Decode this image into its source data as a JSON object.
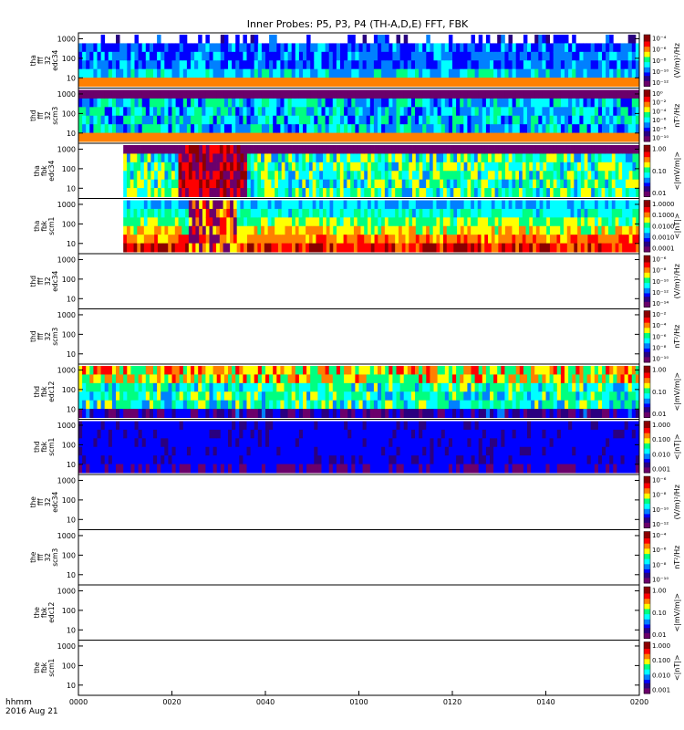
{
  "title": "Inner Probes: P5, P3, P4 (TH-A,D,E) FFT, FBK",
  "footer": {
    "line1": "hhmm",
    "line2": "2016 Aug 21"
  },
  "colors": {
    "colormap": [
      "#ffffff",
      "#6b006b",
      "#2a0080",
      "#0000ff",
      "#0080ff",
      "#00ffff",
      "#00ff80",
      "#ffff00",
      "#ff8000",
      "#ff0000",
      "#8b0000"
    ]
  },
  "chart_data": {
    "type": "heatmap",
    "title": "Inner Probes: P5, P3, P4 (TH-A,D,E) FFT, FBK",
    "x_axis": {
      "label": "hhmm",
      "date": "2016 Aug 21",
      "range": [
        "0000",
        "0200"
      ],
      "tick_labels": [
        "0000",
        "0020",
        "0040",
        "0100",
        "0120",
        "0140",
        "0200"
      ]
    },
    "y_axis": {
      "scale": "log",
      "unit": "Hz",
      "tick_labels": [
        "10",
        "100",
        "1000"
      ],
      "range": [
        3,
        2000
      ]
    },
    "panels": [
      {
        "label": [
          "tha",
          "fff",
          "32",
          "edc34"
        ],
        "colorbar_title": "(V/m)²/Hz",
        "colorbar_ticks": [
          "10⁻⁴",
          "10⁻⁶",
          "10⁻⁸",
          "10⁻¹⁰",
          "10⁻¹²"
        ],
        "pattern": "spiky"
      },
      {
        "label": [
          "thd",
          "fff",
          "32",
          "scm3"
        ],
        "colorbar_title": "nT²/Hz",
        "colorbar_ticks": [
          "10⁰",
          "10⁻²",
          "10⁻⁴",
          "10⁻⁶",
          "10⁻⁸",
          "10⁻¹⁰"
        ],
        "pattern": "scm_fff"
      },
      {
        "label": [
          "tha",
          "fbk",
          "edc34"
        ],
        "colorbar_title": "<|mV/m|>",
        "colorbar_ticks": [
          "1.00",
          "0.10",
          "0.01"
        ],
        "pattern": "fbk_a_edc"
      },
      {
        "label": [
          "tha",
          "fbk",
          "scm1"
        ],
        "colorbar_title": "<|nT|>",
        "colorbar_ticks": [
          "1.0000",
          "0.1000",
          "0.0100",
          "0.0010",
          "0.0001"
        ],
        "pattern": "fbk_a_scm"
      },
      {
        "label": [
          "thd",
          "fff",
          "32",
          "edc34"
        ],
        "colorbar_title": "(V/m)²/Hz",
        "colorbar_ticks": [
          "10⁻⁶",
          "10⁻⁸",
          "10⁻¹⁰",
          "10⁻¹²",
          "10⁻¹⁴"
        ],
        "pattern": "empty"
      },
      {
        "label": [
          "thd",
          "fff",
          "32",
          "scm3"
        ],
        "colorbar_title": "nT²/Hz",
        "colorbar_ticks": [
          "10⁻²",
          "10⁻⁴",
          "10⁻⁶",
          "10⁻⁸",
          "10⁻¹⁰"
        ],
        "pattern": "empty"
      },
      {
        "label": [
          "thd",
          "fbk",
          "edc12"
        ],
        "colorbar_title": "<|mV/m|>",
        "colorbar_ticks": [
          "1.00",
          "0.10",
          "0.01"
        ],
        "pattern": "fbk_d_edc"
      },
      {
        "label": [
          "thd",
          "fbk",
          "scm1"
        ],
        "colorbar_title": "<|nT|>",
        "colorbar_ticks": [
          "1.000",
          "0.100",
          "0.010",
          "0.001"
        ],
        "pattern": "fbk_d_scm"
      },
      {
        "label": [
          "the",
          "fff",
          "32",
          "edc34"
        ],
        "colorbar_title": "(V/m)²/Hz",
        "colorbar_ticks": [
          "10⁻⁶",
          "10⁻⁸",
          "10⁻¹⁰",
          "10⁻¹²"
        ],
        "pattern": "empty"
      },
      {
        "label": [
          "the",
          "fff",
          "32",
          "scm3"
        ],
        "colorbar_title": "nT²/Hz",
        "colorbar_ticks": [
          "10⁻⁴",
          "10⁻⁶",
          "10⁻⁸",
          "10⁻¹⁰"
        ],
        "pattern": "empty"
      },
      {
        "label": [
          "the",
          "fbk",
          "edc12"
        ],
        "colorbar_title": "<|mV/m|>",
        "colorbar_ticks": [
          "1.00",
          "0.10",
          "0.01"
        ],
        "pattern": "empty"
      },
      {
        "label": [
          "the",
          "fbk",
          "scm1"
        ],
        "colorbar_title": "<|nT|>",
        "colorbar_ticks": [
          "1.000",
          "0.100",
          "0.010",
          "0.001"
        ],
        "pattern": "empty"
      }
    ]
  }
}
